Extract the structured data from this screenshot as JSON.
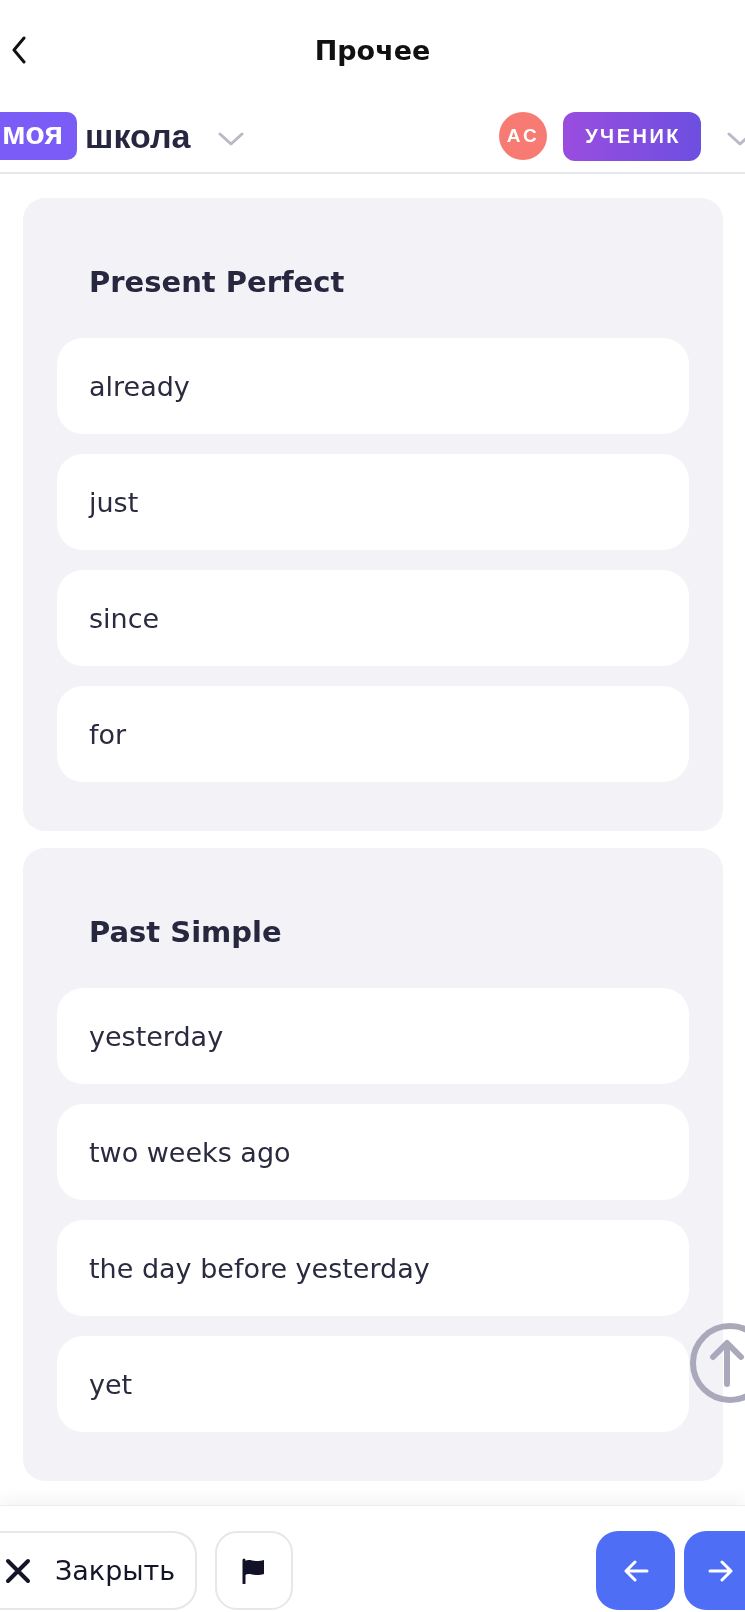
{
  "header": {
    "title": "Прочее"
  },
  "topbar": {
    "logo_badge": "моя",
    "logo_text": "школа",
    "avatar_initials": "АС",
    "role": "УЧЕНИК"
  },
  "groups": [
    {
      "title": "Present Perfect",
      "items": [
        "already",
        "just",
        "since",
        "for"
      ]
    },
    {
      "title": "Past Simple",
      "items": [
        "yesterday",
        "two weeks ago",
        "the day before yesterday",
        "yet"
      ]
    }
  ],
  "footer": {
    "close_label": "Закрыть"
  }
}
